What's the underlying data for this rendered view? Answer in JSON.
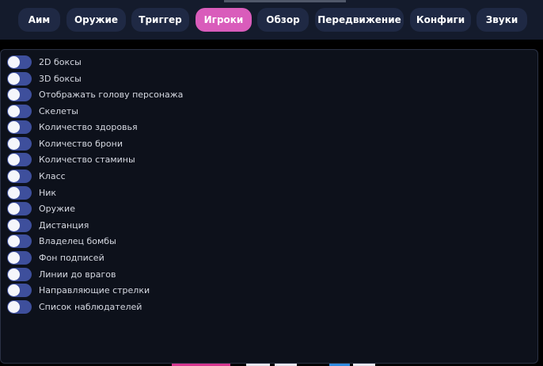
{
  "colors": {
    "header_bg": "#141b2c",
    "tab_bg": "#1f2944",
    "tab_active_bg": "#d95cbb",
    "panel_bg": "#0d111b",
    "toggle_track": "#3e4f9c",
    "toggle_knob": "#f5f6fb"
  },
  "tabs": [
    {
      "label": "Аим",
      "active": false
    },
    {
      "label": "Оружие",
      "active": false
    },
    {
      "label": "Триггер",
      "active": false
    },
    {
      "label": "Игроки",
      "active": true
    },
    {
      "label": "Обзор",
      "active": false
    },
    {
      "label": "Передвижение",
      "active": false
    },
    {
      "label": "Конфиги",
      "active": false
    },
    {
      "label": "Звуки",
      "active": false
    }
  ],
  "options": [
    {
      "label": "2D боксы",
      "enabled": false
    },
    {
      "label": "3D боксы",
      "enabled": false
    },
    {
      "label": "Отображать голову персонажа",
      "enabled": false
    },
    {
      "label": "Скелеты",
      "enabled": false
    },
    {
      "label": "Количество здоровья",
      "enabled": false
    },
    {
      "label": "Количество брони",
      "enabled": false
    },
    {
      "label": "Количество стамины",
      "enabled": false
    },
    {
      "label": "Класс",
      "enabled": false
    },
    {
      "label": "Ник",
      "enabled": false
    },
    {
      "label": "Оружие",
      "enabled": false
    },
    {
      "label": "Дистанция",
      "enabled": false
    },
    {
      "label": "Владелец бомбы",
      "enabled": false
    },
    {
      "label": "Фон подписей",
      "enabled": false
    },
    {
      "label": "Линии до врагов",
      "enabled": false
    },
    {
      "label": "Направляющие стрелки",
      "enabled": false
    },
    {
      "label": "Список наблюдателей",
      "enabled": false
    }
  ]
}
